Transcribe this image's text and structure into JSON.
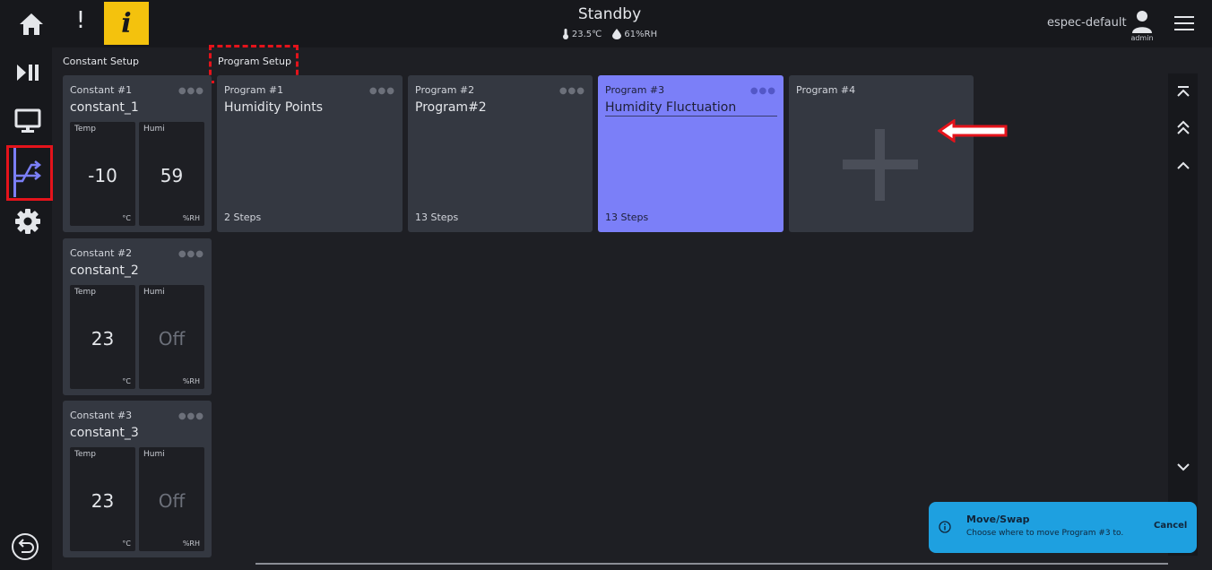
{
  "header": {
    "status": "Standby",
    "temperature": "23.5℃",
    "humidity": "61%RH",
    "profile": "espec-default",
    "user_role": "admin"
  },
  "sections": {
    "constant_title": "Constant Setup",
    "program_title": "Program Setup"
  },
  "constants": [
    {
      "number": "Constant #1",
      "name": "constant_1",
      "temp_label": "Temp",
      "humi_label": "Humi",
      "temp_value": "-10",
      "humi_value": "59",
      "temp_unit": "°C",
      "humi_unit": "%RH"
    },
    {
      "number": "Constant #2",
      "name": "constant_2",
      "temp_label": "Temp",
      "humi_label": "Humi",
      "temp_value": "23",
      "humi_value": "Off",
      "temp_unit": "°C",
      "humi_unit": "%RH"
    },
    {
      "number": "Constant #3",
      "name": "constant_3",
      "temp_label": "Temp",
      "humi_label": "Humi",
      "temp_value": "23",
      "humi_value": "Off",
      "temp_unit": "°C",
      "humi_unit": "%RH"
    }
  ],
  "programs": [
    {
      "number": "Program #1",
      "name": "Humidity Points",
      "steps": "2 Steps"
    },
    {
      "number": "Program #2",
      "name": "Program#2",
      "steps": "13 Steps"
    },
    {
      "number": "Program #3",
      "name": "Humidity Fluctuation",
      "steps": "13 Steps"
    },
    {
      "number": "Program #4"
    }
  ],
  "toast": {
    "title": "Move/Swap",
    "message": "Choose where to move Program #3 to.",
    "cancel_label": "Cancel"
  },
  "colors": {
    "accent": "#7b7ff8",
    "toast": "#1ea0e0",
    "info": "#f4c20d",
    "annotation": "#e4131b"
  }
}
